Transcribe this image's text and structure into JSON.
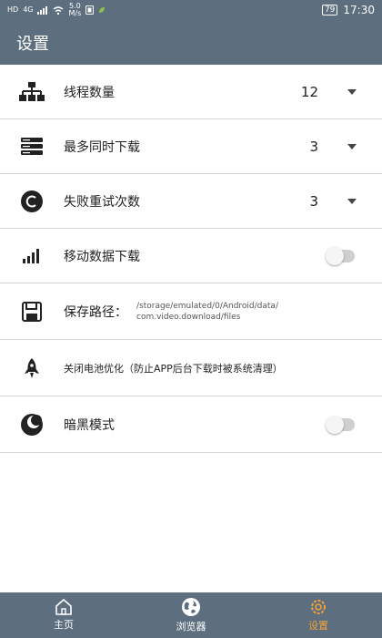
{
  "status_bar": {
    "left_text": "HD",
    "signal_text": "4G",
    "speed_value": "5.0",
    "speed_unit": "M/s",
    "battery": "79",
    "time": "17:30"
  },
  "header": {
    "title": "设置"
  },
  "settings": [
    {
      "label": "线程数量",
      "value": "12",
      "icon": "network-icon"
    },
    {
      "label": "最多同时下载",
      "value": "3",
      "icon": "server-stack-icon"
    },
    {
      "label": "失败重试次数",
      "value": "3",
      "icon": "retry-icon"
    },
    {
      "label": "移动数据下载",
      "icon": "signal-bars-icon",
      "toggle_on": false
    },
    {
      "label": "保存路径：",
      "path": "/storage/emulated/0/Android/data/\ncom.video.download/files",
      "icon": "save-icon"
    },
    {
      "label": "关闭电池优化（防止APP后台下载时被系统清理）",
      "icon": "rocket-icon"
    },
    {
      "label": "暗黑模式",
      "icon": "moon-icon",
      "toggle_on": false
    }
  ],
  "tabs": [
    {
      "label": "主页",
      "icon": "home-icon"
    },
    {
      "label": "浏览器",
      "icon": "globe-icon"
    },
    {
      "label": "设置",
      "icon": "gear-icon",
      "active": true
    }
  ],
  "colors": {
    "bar": "#5d6f7e",
    "accent": "#f2a33a"
  }
}
